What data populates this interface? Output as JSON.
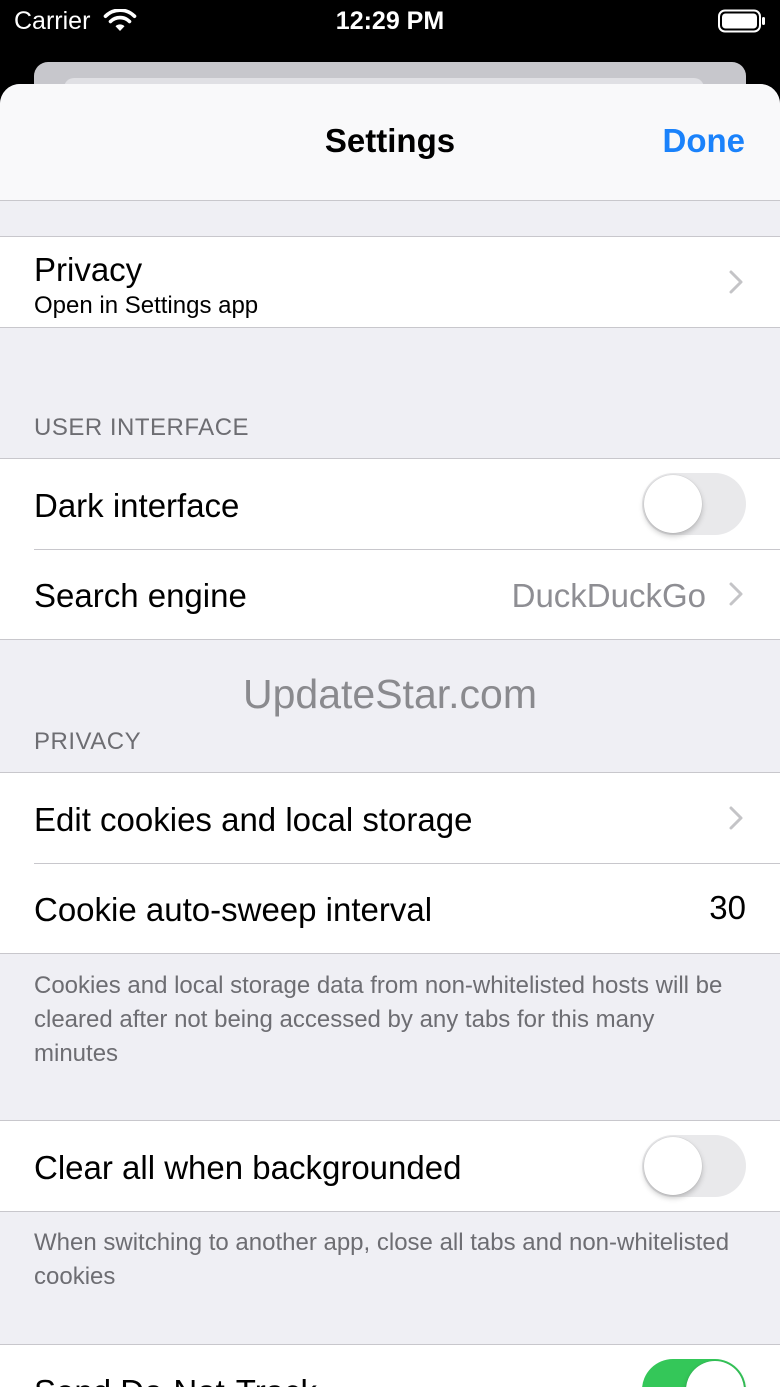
{
  "status_bar": {
    "carrier": "Carrier",
    "time": "12:29 PM"
  },
  "nav": {
    "title": "Settings",
    "done_label": "Done",
    "done_color": "#1a82fb"
  },
  "privacy_link": {
    "title": "Privacy",
    "subtitle": "Open in Settings app"
  },
  "user_interface": {
    "header": "USER INTERFACE",
    "dark_interface_label": "Dark interface",
    "dark_interface_on": false,
    "search_engine_label": "Search engine",
    "search_engine_value": "DuckDuckGo"
  },
  "watermark": "UpdateStar.com",
  "privacy_section": {
    "header": "PRIVACY",
    "edit_cookies_label": "Edit cookies and local storage",
    "auto_sweep_label": "Cookie auto-sweep interval",
    "auto_sweep_value": "30",
    "auto_sweep_footer": "Cookies and local storage data from non-whitelisted hosts will be cleared after not being accessed by any tabs for this many minutes",
    "clear_all_label": "Clear all when backgrounded",
    "clear_all_on": false,
    "clear_all_footer": "When switching to another app, close all tabs and non-whitelisted cookies",
    "dnt_label": "Send Do-Not-Track",
    "dnt_on": true
  },
  "colors": {
    "toggle_on": "#34c759",
    "toggle_off": "#e9e9eb",
    "group_background": "#efeff4"
  }
}
